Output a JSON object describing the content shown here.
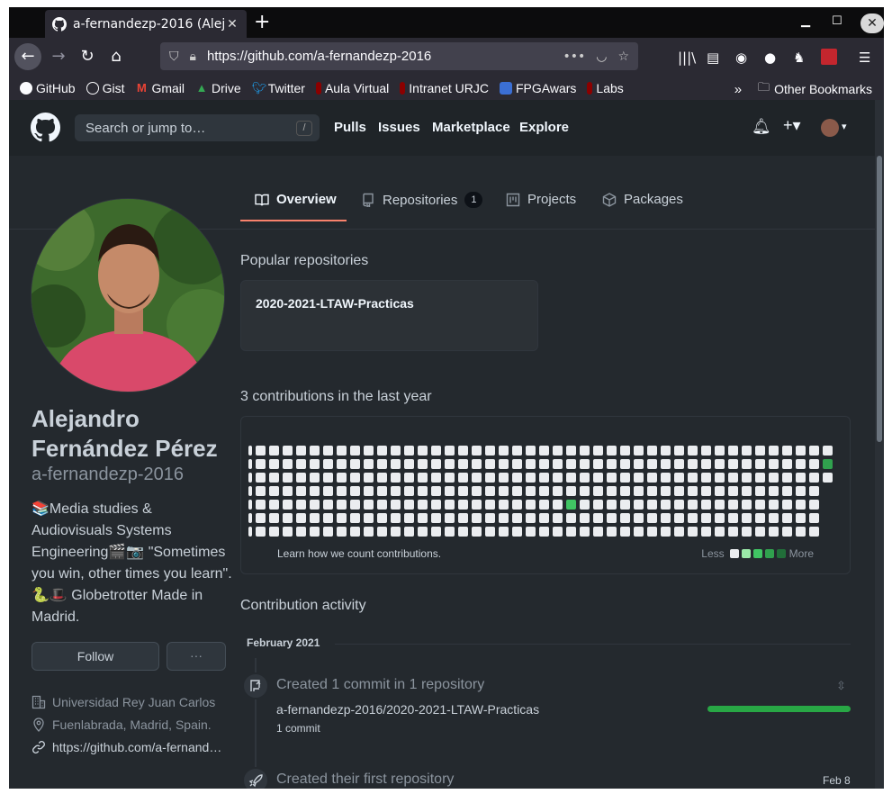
{
  "browser": {
    "tab_title": "a-fernandezp-2016 (Alejandro",
    "url": "https://github.com/a-fernandezp-2016",
    "bookmarks": [
      {
        "label": "GitHub",
        "icon": "github-icon"
      },
      {
        "label": "Gist",
        "icon": "globe-icon"
      },
      {
        "label": "Gmail",
        "icon": "gmail-icon"
      },
      {
        "label": "Drive",
        "icon": "drive-icon"
      },
      {
        "label": "Twitter",
        "icon": "twitter-icon"
      },
      {
        "label": "Aula Virtual",
        "icon": "urjc-icon"
      },
      {
        "label": "Intranet URJC",
        "icon": "urjc-icon"
      },
      {
        "label": "FPGAwars",
        "icon": "fpga-icon"
      },
      {
        "label": "Labs",
        "icon": "urjc-icon"
      }
    ],
    "other_bookmarks": "Other Bookmarks"
  },
  "header": {
    "search_placeholder": "Search or jump to…",
    "slash": "/",
    "nav": [
      "Pulls",
      "Issues",
      "Marketplace",
      "Explore"
    ]
  },
  "tabs": [
    {
      "label": "Overview",
      "active": true
    },
    {
      "label": "Repositories",
      "count": "1"
    },
    {
      "label": "Projects"
    },
    {
      "label": "Packages"
    }
  ],
  "profile": {
    "name_line1": "Alejandro",
    "name_line2": "Fernández Pérez",
    "login": "a-fernandezp-2016",
    "bio": "📚Media studies & Audiovisuals Systems Engineering🎬📷 \"Sometimes you win, other times you learn\".🐍🎩 Globetrotter Made in Madrid.",
    "follow_label": "Follow",
    "more_label": "···",
    "organization": "Universidad Rey Juan Carlos",
    "location": "Fuenlabrada, Madrid, Spain.",
    "website": "https://github.com/a-fernand…"
  },
  "popular": {
    "heading": "Popular repositories",
    "repos": [
      "2020-2021-LTAW-Practicas"
    ]
  },
  "contributions": {
    "heading": "3 contributions in the last year",
    "learn": "Learn how we count contributions.",
    "less": "Less",
    "more": "More",
    "colors": [
      "#ebedf0",
      "#9be9a8",
      "#40c463",
      "#30a14e",
      "#216e39"
    ]
  },
  "activity": {
    "heading": "Contribution activity",
    "month": "February 2021",
    "item1_title": "Created 1 commit in 1 repository",
    "item1_repo": "a-fernandezp-2016/2020-2021-LTAW-Practicas",
    "item1_count": "1 commit",
    "item2_title": "Created their first repository",
    "item2_date": "Feb 8"
  }
}
